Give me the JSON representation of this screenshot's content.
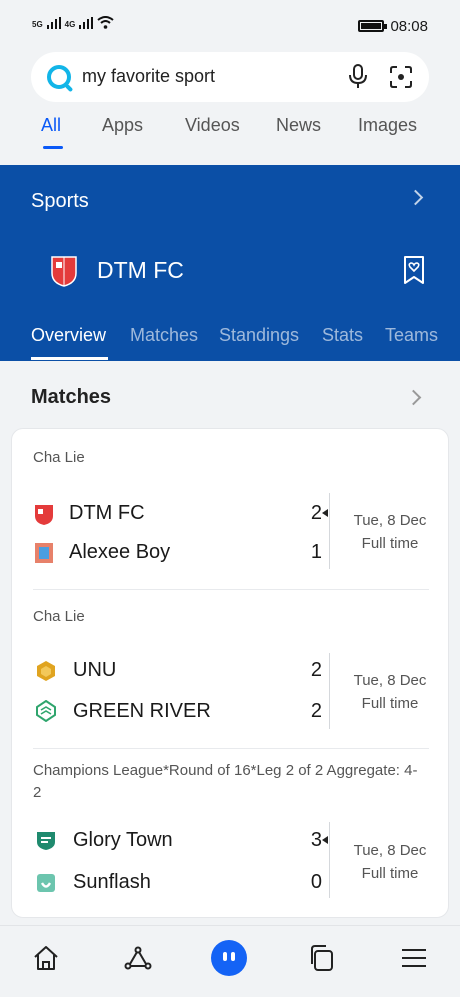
{
  "status": {
    "network1": "5G",
    "network2": "4G",
    "time": "08:08"
  },
  "search": {
    "query": "my favorite sport"
  },
  "top_tabs": [
    {
      "label": "All"
    },
    {
      "label": "Apps"
    },
    {
      "label": "Videos"
    },
    {
      "label": "News"
    },
    {
      "label": "Images"
    }
  ],
  "sports_card": {
    "title": "Sports",
    "team_name": "DTM FC",
    "sub_tabs": [
      {
        "label": "Overview"
      },
      {
        "label": "Matches"
      },
      {
        "label": "Standings"
      },
      {
        "label": "Stats"
      },
      {
        "label": "Teams"
      }
    ]
  },
  "matches": {
    "title": "Matches",
    "items": [
      {
        "league": "Cha Lie",
        "home": {
          "name": "DTM FC",
          "score": "2"
        },
        "away": {
          "name": "Alexee Boy",
          "score": "1"
        },
        "date": "Tue, 8 Dec",
        "status": "Full time"
      },
      {
        "league": "Cha Lie",
        "home": {
          "name": "UNU",
          "score": "2"
        },
        "away": {
          "name": "GREEN RIVER",
          "score": "2"
        },
        "date": "Tue, 8 Dec",
        "status": "Full time"
      },
      {
        "league": "Champions League*Round of 16*Leg 2 of 2 Aggregate: 4-2",
        "home": {
          "name": "Glory Town",
          "score": "3"
        },
        "away": {
          "name": "Sunflash",
          "score": "0"
        },
        "date": "Tue, 8 Dec",
        "status": "Full time"
      }
    ]
  },
  "colors": {
    "accent": "#0a59f7",
    "card_blue": "#0b4fa6",
    "assistant": "#1463f5"
  }
}
